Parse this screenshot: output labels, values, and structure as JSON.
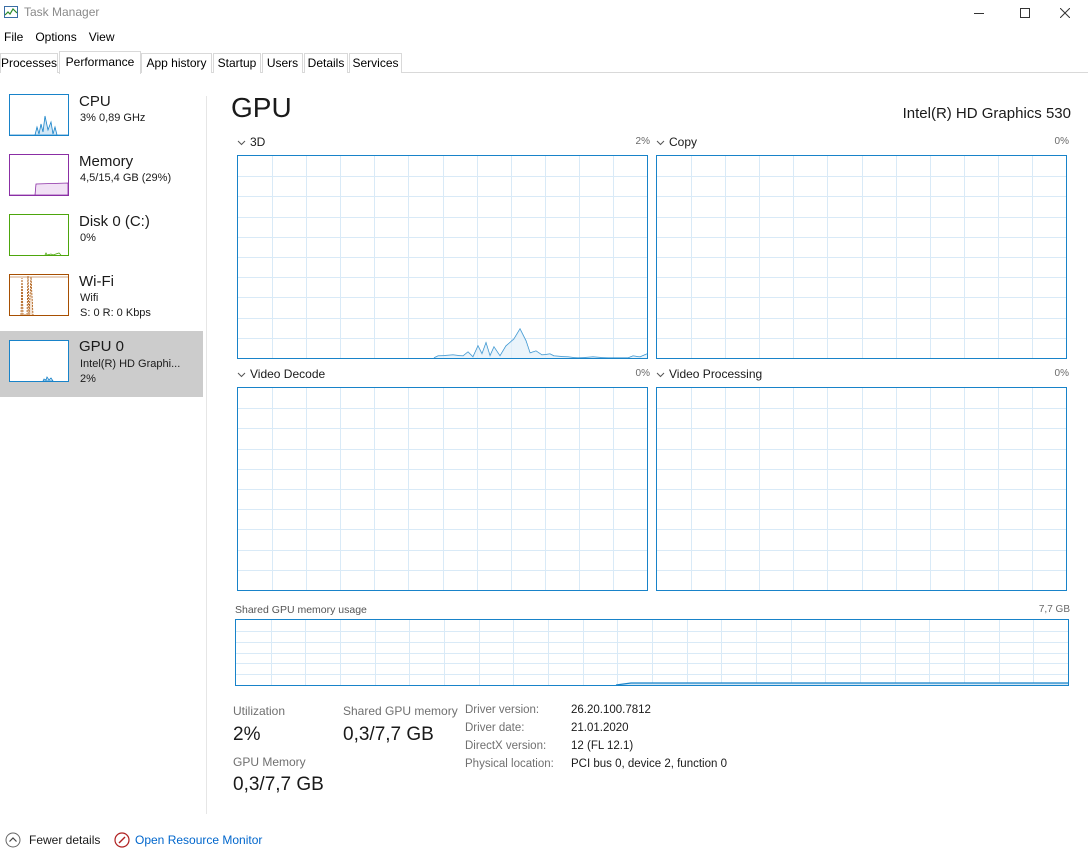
{
  "window": {
    "title": "Task Manager",
    "app_icon": "task-manager-icon",
    "controls": [
      "minimize-icon",
      "maximize-icon",
      "close-icon"
    ]
  },
  "menu": [
    "File",
    "Options",
    "View"
  ],
  "tabs": [
    "Processes",
    "Performance",
    "App history",
    "Startup",
    "Users",
    "Details",
    "Services"
  ],
  "active_tab": "Performance",
  "sidebar": {
    "items": [
      {
        "name": "CPU",
        "lines": [
          "3% 0,89 GHz"
        ],
        "color": "#1883c9"
      },
      {
        "name": "Memory",
        "lines": [
          "4,5/15,4 GB (29%)"
        ],
        "color": "#8b2ea5"
      },
      {
        "name": "Disk 0 (C:)",
        "lines": [
          "0%"
        ],
        "color": "#4da60c"
      },
      {
        "name": "Wi-Fi",
        "lines": [
          "Wifi",
          "S: 0 R: 0 Kbps"
        ],
        "color": "#a74f01"
      },
      {
        "name": "GPU 0",
        "lines": [
          "Intel(R) HD Graphi...",
          "2%"
        ],
        "color": "#1883c9"
      }
    ],
    "selected_index": 4
  },
  "main": {
    "title": "GPU",
    "model": "Intel(R) HD Graphics 530",
    "engines": [
      {
        "label": "3D",
        "percent": "2%"
      },
      {
        "label": "Copy",
        "percent": "0%"
      },
      {
        "label": "Video Decode",
        "percent": "0%"
      },
      {
        "label": "Video Processing",
        "percent": "0%"
      }
    ],
    "shared_memory_graph": {
      "label": "Shared GPU memory usage",
      "max": "7,7 GB"
    },
    "stats": {
      "utilization_label": "Utilization",
      "utilization_value": "2%",
      "shared_gpu_memory_label": "Shared GPU memory",
      "shared_gpu_memory_value": "0,3/7,7 GB",
      "gpu_memory_label": "GPU Memory",
      "gpu_memory_value": "0,3/7,7 GB"
    },
    "info": [
      {
        "label": "Driver version:",
        "value": "26.20.100.7812"
      },
      {
        "label": "Driver date:",
        "value": "21.01.2020"
      },
      {
        "label": "DirectX version:",
        "value": "12 (FL 12.1)"
      },
      {
        "label": "Physical location:",
        "value": "PCI bus 0, device 2, function 0"
      }
    ]
  },
  "footer": {
    "fewer_details": "Fewer details",
    "open_resource_monitor": "Open Resource Monitor"
  },
  "colors": {
    "accent": "#1883c9",
    "link": "#0066cc",
    "selected_bg": "#cccccc"
  }
}
